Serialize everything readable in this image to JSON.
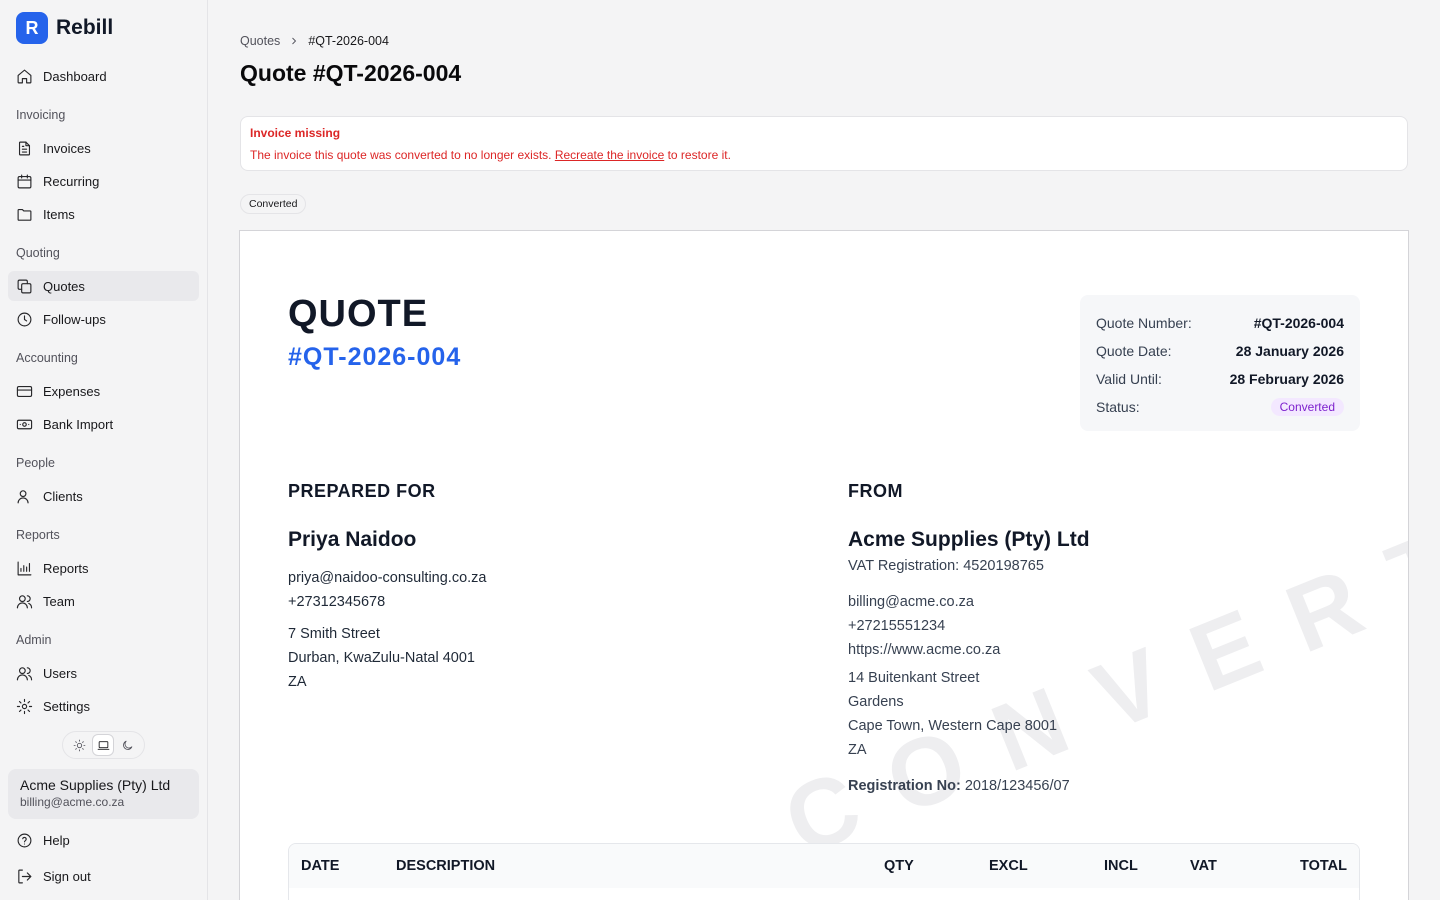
{
  "app": {
    "name": "Rebill",
    "logo_letter": "R",
    "accent": "#2563eb"
  },
  "sidebar": {
    "dashboard": "Dashboard",
    "sections": {
      "invoicing": "Invoicing",
      "quoting": "Quoting",
      "accounting": "Accounting",
      "people": "People",
      "reports": "Reports",
      "admin": "Admin"
    },
    "items": {
      "invoices": "Invoices",
      "recurring": "Recurring",
      "items": "Items",
      "quotes": "Quotes",
      "followups": "Follow-ups",
      "expenses": "Expenses",
      "bank_import": "Bank Import",
      "clients": "Clients",
      "reports": "Reports",
      "team": "Team",
      "users": "Users",
      "settings": "Settings"
    },
    "active_item": "Quotes",
    "theme_options": [
      "light",
      "system",
      "dark"
    ],
    "theme_selected": "system",
    "account": {
      "name": "Acme Supplies (Pty) Ltd",
      "email": "billing@acme.co.za"
    },
    "help": "Help",
    "sign_out": "Sign out"
  },
  "breadcrumb": {
    "parent": "Quotes",
    "current": "#QT-2026-004"
  },
  "page_title": "Quote #QT-2026-004",
  "alert": {
    "title": "Invoice missing",
    "text_before": "The invoice this quote was converted to no longer exists. ",
    "link": "Recreate the invoice",
    "text_after": " to restore it.",
    "color": "#dc2626"
  },
  "status_chip": "Converted",
  "document": {
    "title": "QUOTE",
    "number": "#QT-2026-004",
    "watermark": "CONVERTED",
    "meta": {
      "quote_number_label": "Quote Number:",
      "quote_number": "#QT-2026-004",
      "quote_date_label": "Quote Date:",
      "quote_date": "28 January 2026",
      "valid_until_label": "Valid Until:",
      "valid_until": "28 February 2026",
      "status_label": "Status:",
      "status": "Converted"
    },
    "prepared_for": {
      "heading": "PREPARED FOR",
      "name": "Priya Naidoo",
      "email": "priya@naidoo-consulting.co.za",
      "phone": "+27312345678",
      "address1": "7 Smith Street",
      "address2": "Durban, KwaZulu-Natal 4001",
      "country": "ZA"
    },
    "from": {
      "heading": "FROM",
      "name": "Acme Supplies (Pty) Ltd",
      "vat": "VAT Registration: 4520198765",
      "email": "billing@acme.co.za",
      "phone": "+27215551234",
      "website": "https://www.acme.co.za",
      "address1": "14 Buitenkant Street",
      "address2": "Gardens",
      "address3": "Cape Town, Western Cape 8001",
      "country": "ZA",
      "registration_label": "Registration No:",
      "registration": "2018/123456/07"
    },
    "table_headers": {
      "date": "DATE",
      "description": "DESCRIPTION",
      "qty": "QTY",
      "excl": "EXCL",
      "incl": "INCL",
      "vat": "VAT",
      "total": "TOTAL"
    }
  }
}
